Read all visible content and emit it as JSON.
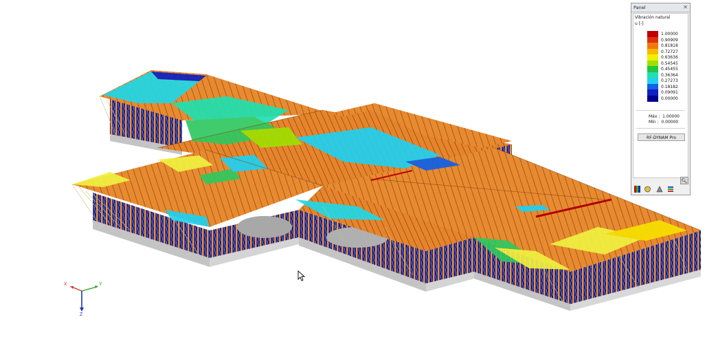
{
  "panel": {
    "title": "Panel",
    "heading": "Vibración natural",
    "unit": "u [-]",
    "legend": [
      {
        "value": "1.00000",
        "color": "#c00000"
      },
      {
        "value": "0.90909",
        "color": "#e03010"
      },
      {
        "value": "0.81818",
        "color": "#f07810"
      },
      {
        "value": "0.72727",
        "color": "#f8b800"
      },
      {
        "value": "0.63636",
        "color": "#f0f000"
      },
      {
        "value": "0.54545",
        "color": "#a0e000"
      },
      {
        "value": "0.45455",
        "color": "#20c840"
      },
      {
        "value": "0.36364",
        "color": "#20e0b0"
      },
      {
        "value": "0.27273",
        "color": "#20d0f0"
      },
      {
        "value": "0.18182",
        "color": "#1060e8"
      },
      {
        "value": "0.09091",
        "color": "#1020c0"
      },
      {
        "value": "0.00000",
        "color": "#000090"
      }
    ],
    "max_label": "Máx",
    "max_value": "1.00000",
    "min_label": "Mín",
    "min_value": "0.00000",
    "button_label": "RF-DYNAM Pro"
  },
  "axes": {
    "x": "X",
    "y": "Y",
    "z": "Z"
  },
  "colors": {
    "beam": "#e8822a",
    "post": "#f09030",
    "slab_blue": "#0a1a9c",
    "base": "#c8c8c8",
    "cyan": "#20d8e8",
    "yellow": "#f0f040",
    "green": "#30c860"
  }
}
